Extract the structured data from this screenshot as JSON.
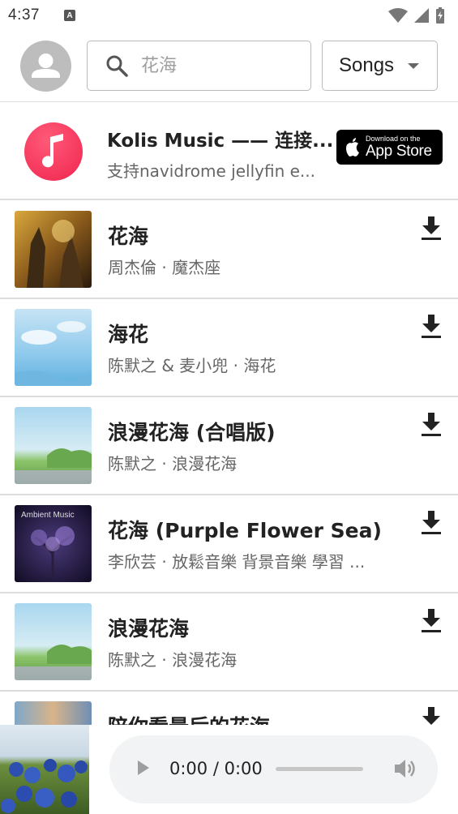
{
  "status_bar": {
    "time": "4:37",
    "notification_letter": "A"
  },
  "header": {
    "search_placeholder": "花海",
    "filter_selected": "Songs"
  },
  "promo": {
    "title": "Kolis Music —— 连接...",
    "subtitle": "支持navidrome jellyfin e...",
    "badge_small": "Download on the",
    "badge_big": "App Store"
  },
  "songs": [
    {
      "title": "花海",
      "subtitle": "周杰倫 · 魔杰座"
    },
    {
      "title": "海花",
      "subtitle": "陈默之 & 麦小兜 · 海花"
    },
    {
      "title": "浪漫花海 (合唱版)",
      "subtitle": "陈默之 · 浪漫花海"
    },
    {
      "title": "花海 (Purple Flower Sea)",
      "subtitle": "李欣芸 · 放鬆音樂 背景音樂 學習 ...",
      "cover_text": "Ambient Music"
    },
    {
      "title": "浪漫花海",
      "subtitle": "陈默之 · 浪漫花海"
    },
    {
      "title": "陪你看最后的花海",
      "subtitle": ""
    }
  ],
  "player": {
    "time": "0:00 / 0:00",
    "progress": 0
  },
  "icons": [
    "signal-wifi-icon",
    "signal-cell-icon",
    "battery-icon",
    "person-icon",
    "search-icon",
    "caret-down-icon",
    "music-note-icon",
    "apple-icon",
    "download-icon",
    "play-icon",
    "volume-icon"
  ]
}
